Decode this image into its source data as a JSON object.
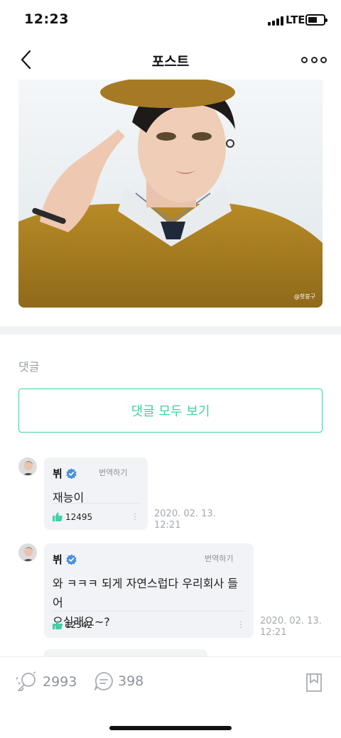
{
  "status_bar": {
    "time": "12:23",
    "network": "LTE"
  },
  "nav": {
    "title": "포스트",
    "back_icon": "chevron-left-icon",
    "more_icon": "more-dots-icon"
  },
  "post_image": {
    "alt": "",
    "watermark": "@핫붕구"
  },
  "comments": {
    "label": "댓글",
    "view_all": "댓글 모두 보기",
    "items": [
      {
        "name": "뷔",
        "verified": true,
        "translate": "번역하기",
        "text": "재능이",
        "likes": "12495",
        "date_line1": "2020. 02. 13.",
        "date_line2": "12:21"
      },
      {
        "name": "뷔",
        "verified": true,
        "translate": "번역하기",
        "text_line1": "와 ㅋㅋㅋ 되게 자연스럽다 우리회사 들어",
        "text_line2": "오실래요~?",
        "likes": "12542",
        "date_line1": "2020. 02. 13.",
        "date_line2": "12:21"
      }
    ]
  },
  "bottom_bar": {
    "cheer_count": "2993",
    "comment_count": "398",
    "cheer_icon": "cheer-icon",
    "comment_icon": "comment-bubble-icon",
    "bookmark_icon": "bookmark-icon"
  },
  "colors": {
    "accent": "#3fd1a3",
    "bubble_bg": "#f2f3f6",
    "verified": "#4a90e2"
  }
}
